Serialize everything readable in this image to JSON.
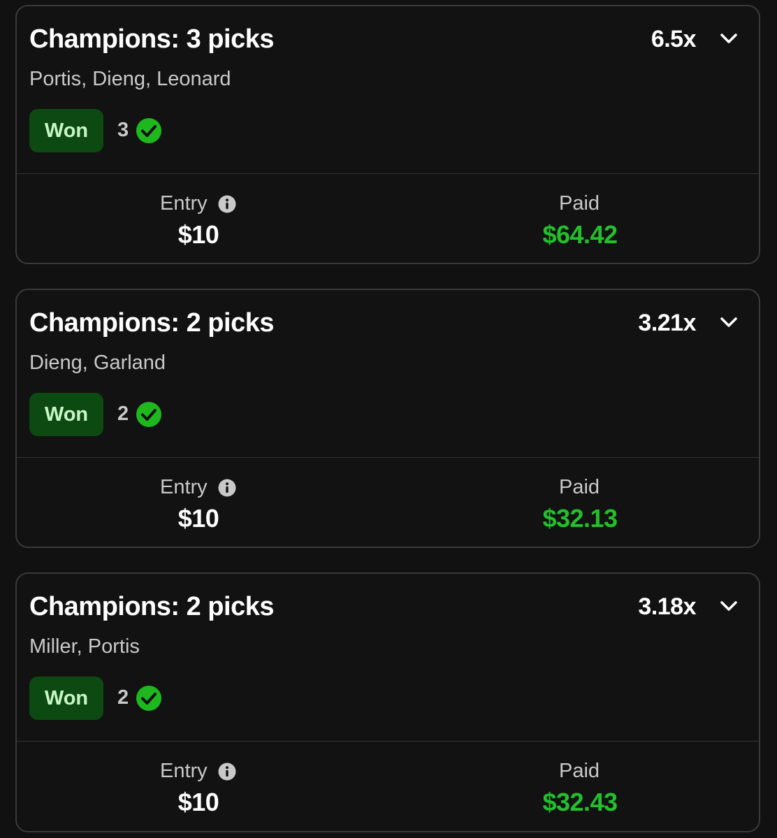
{
  "colors": {
    "background": "#111111",
    "card_border": "#3a3a3a",
    "won_pill_bg": "#0d4a12",
    "won_pill_text": "#c8f5c8",
    "check_green": "#1eb81e",
    "paid_green": "#22c02b"
  },
  "entries": [
    {
      "title": "Champions: 3 picks",
      "multiplier": "6.5x",
      "players": "Portis, Dieng, Leonard",
      "status": "Won",
      "correct_count": "3",
      "entry_label": "Entry",
      "entry_value": "$10",
      "paid_label": "Paid",
      "paid_value": "$64.42",
      "icons": [
        "chevron-down-icon",
        "check-circle-icon",
        "info-icon"
      ]
    },
    {
      "title": "Champions: 2 picks",
      "multiplier": "3.21x",
      "players": "Dieng, Garland",
      "status": "Won",
      "correct_count": "2",
      "entry_label": "Entry",
      "entry_value": "$10",
      "paid_label": "Paid",
      "paid_value": "$32.13",
      "icons": [
        "chevron-down-icon",
        "check-circle-icon",
        "info-icon"
      ]
    },
    {
      "title": "Champions: 2 picks",
      "multiplier": "3.18x",
      "players": "Miller, Portis",
      "status": "Won",
      "correct_count": "2",
      "entry_label": "Entry",
      "entry_value": "$10",
      "paid_label": "Paid",
      "paid_value": "$32.43",
      "icons": [
        "chevron-down-icon",
        "check-circle-icon",
        "info-icon"
      ]
    }
  ]
}
